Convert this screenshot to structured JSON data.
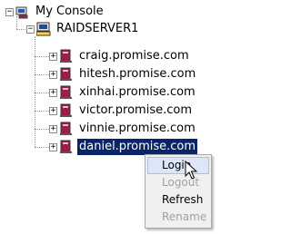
{
  "tree": {
    "root": {
      "label": "My Console",
      "icon": "console-icon",
      "expander": "−"
    },
    "server": {
      "label": "RAIDSERVER1",
      "icon": "server-icon",
      "expander": "−"
    },
    "hosts": [
      {
        "label": "craig.promise.com",
        "icon": "host-icon",
        "expander": "+"
      },
      {
        "label": "hitesh.promise.com",
        "icon": "host-icon",
        "expander": "+"
      },
      {
        "label": "xinhai.promise.com",
        "icon": "host-icon",
        "expander": "+"
      },
      {
        "label": "victor.promise.com",
        "icon": "host-icon",
        "expander": "+"
      },
      {
        "label": "vinnie.promise.com",
        "icon": "host-icon",
        "expander": "+"
      },
      {
        "label": "daniel.promise.com",
        "icon": "host-icon",
        "expander": "+",
        "selected": true
      }
    ]
  },
  "context_menu": {
    "items": [
      {
        "label": "Login",
        "enabled": true,
        "highlighted": true
      },
      {
        "label": "Logout",
        "enabled": false
      },
      {
        "label": "Refresh",
        "enabled": true
      },
      {
        "label": "Rename",
        "enabled": false
      }
    ]
  },
  "colors": {
    "selection": "#0a246a",
    "host_icon": "#9c1c4a",
    "server_icon": "#1e4b9c"
  }
}
